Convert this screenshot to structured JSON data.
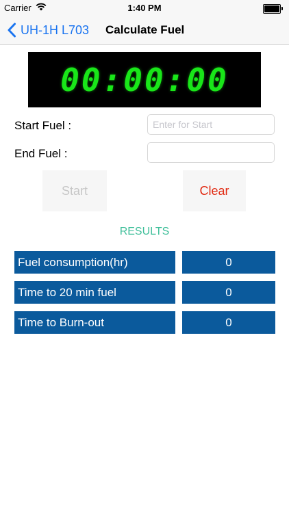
{
  "status_bar": {
    "carrier": "Carrier",
    "time": "1:40 PM",
    "icons": [
      "wifi-icon",
      "battery-icon"
    ]
  },
  "nav": {
    "back_label": "UH-1H L703",
    "title": "Calculate Fuel",
    "icons": [
      "chevron-left-icon"
    ]
  },
  "timer": {
    "display": "00:00:00"
  },
  "form": {
    "start_label": "Start Fuel :",
    "start_placeholder": "Enter for Start",
    "start_value": "",
    "end_label": "End Fuel :",
    "end_placeholder": "",
    "end_value": ""
  },
  "buttons": {
    "start_label": "Start",
    "clear_label": "Clear"
  },
  "results": {
    "title": "RESULTS",
    "rows": [
      {
        "label": "Fuel consumption(hr)",
        "value": "0"
      },
      {
        "label": "Time to 20 min fuel",
        "value": "0"
      },
      {
        "label": "Time to Burn-out",
        "value": "0"
      }
    ]
  },
  "colors": {
    "accent_blue": "#1a74f0",
    "timer_green": "#19e619",
    "clear_red": "#e12a12",
    "results_teal": "#3fbf9a",
    "row_blue": "#0b5a9c"
  }
}
